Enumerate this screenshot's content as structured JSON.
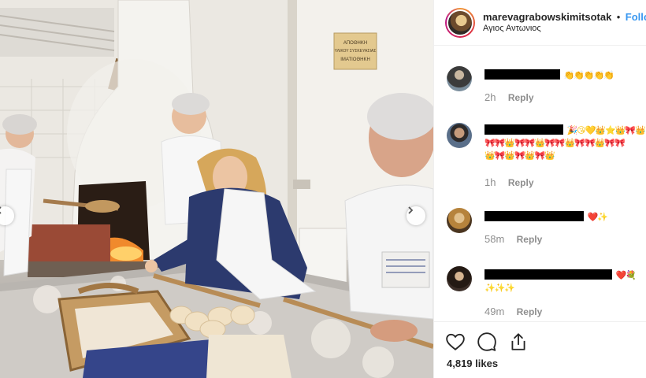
{
  "post": {
    "username": "marevagrabowskimitsotak",
    "separator": "•",
    "follow_label": "Follow",
    "location": "Αγιος Αντωνιος"
  },
  "photo": {
    "sign_lines": [
      "ΑΠΟΘΗΚΗ",
      "ΥΛΙΚΟΥ ΣΥΣΚΕΥΑΣΙΑΣ",
      "ΙΜΑΤΙΟΘΗΚΗ"
    ],
    "left_arrow": "chevron-left-icon",
    "right_arrow": "chevron-right-icon"
  },
  "comments": [
    {
      "emoji": "👏👏👏👏👏",
      "time": "2h",
      "reply": "Reply"
    },
    {
      "emoji": "🎉😘💛👑⭐👑🎀👑",
      "emoji2": "🎀🎀👑🎀🎀👑🎀🎀👑🎀🎀👑🎀🎀",
      "emoji3": "👑🎀👑🎀👑🎀👑",
      "time": "1h",
      "reply": "Reply"
    },
    {
      "emoji": "❤️✨",
      "time": "58m",
      "reply": "Reply"
    },
    {
      "emoji": "❤️💐",
      "emoji2": "✨✨✨",
      "time": "49m",
      "reply": "Reply"
    }
  ],
  "actions": {
    "like_icon": "heart-icon",
    "comment_icon": "comment-icon",
    "share_icon": "share-icon",
    "likes": "4,819 likes"
  },
  "colors": {
    "follow": "#3897f0",
    "text": "#262626",
    "meta": "#8e8e8e"
  }
}
